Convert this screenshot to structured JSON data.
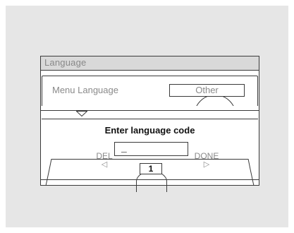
{
  "window": {
    "title": "Language"
  },
  "menu": {
    "label": "Menu Language",
    "value": "Other"
  },
  "dialog": {
    "prompt": "Enter language code",
    "input_value": "_"
  },
  "footer": {
    "del_label": "DEL",
    "done_label": "DONE",
    "page_number": "1"
  },
  "icons": {
    "down": "chevron-down-icon",
    "left": "triangle-left-icon",
    "right": "triangle-right-icon"
  },
  "colors": {
    "background": "#e6e6e6",
    "title_bar": "#d9d9d9",
    "dim_text": "#8a8a8a",
    "border": "#3a3a3a"
  }
}
